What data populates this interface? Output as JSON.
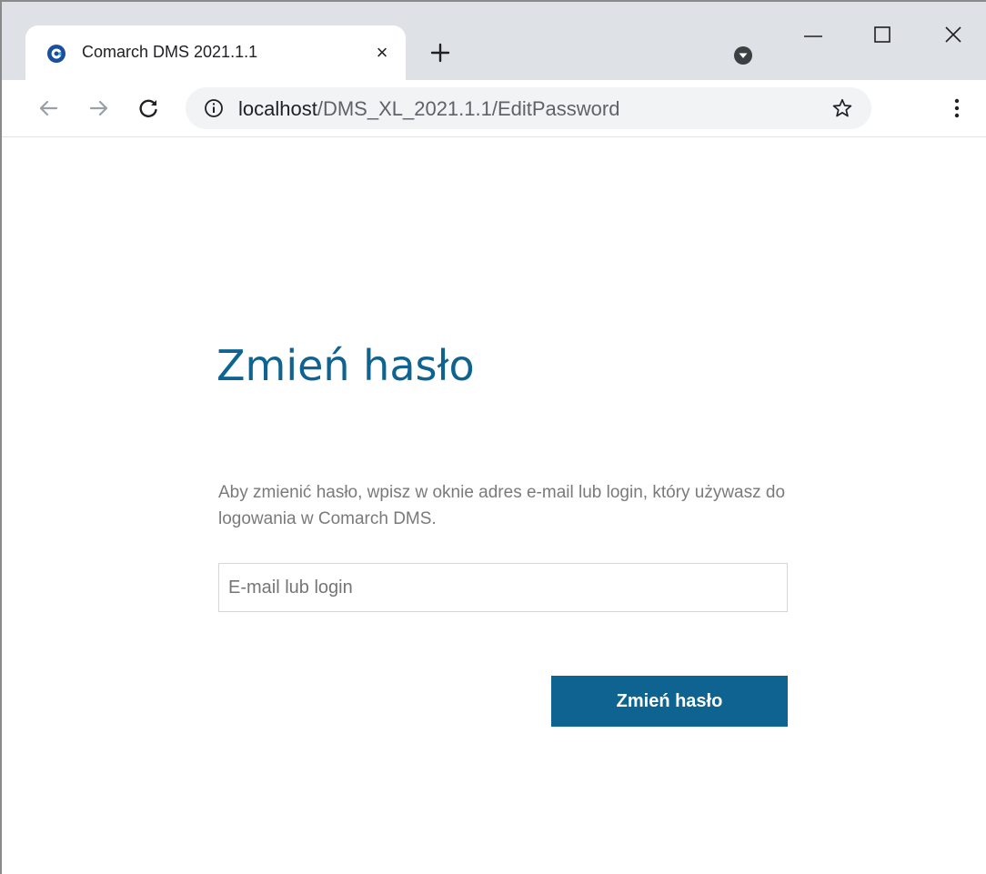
{
  "browser": {
    "tab": {
      "title": "Comarch DMS 2021.1.1",
      "close_label": "×",
      "favicon": "comarch-logo-icon"
    },
    "new_tab_icon": "plus-icon",
    "profile_icon": "profile-dropdown-icon",
    "window_controls": [
      "minimize-icon",
      "maximize-icon",
      "close-icon"
    ],
    "address": {
      "host": "localhost",
      "path": "/DMS_XL_2021.1.1/EditPassword"
    },
    "toolbar_icons": [
      "back-arrow-icon",
      "forward-arrow-icon",
      "reload-icon",
      "info-icon",
      "star-icon",
      "kebab-menu-icon"
    ]
  },
  "page": {
    "title": "Zmień hasło",
    "description": "Aby zmienić hasło, wpisz w oknie adres e-mail lub login, który używasz do logowania w Comarch DMS.",
    "input": {
      "value": "",
      "placeholder": "E-mail lub login"
    },
    "submit_label": "Zmień hasło"
  },
  "colors": {
    "accent": "#0e6391",
    "tabstrip": "#dee1e6",
    "omnibox": "#f1f3f4",
    "description_text": "#7a7a7a"
  }
}
